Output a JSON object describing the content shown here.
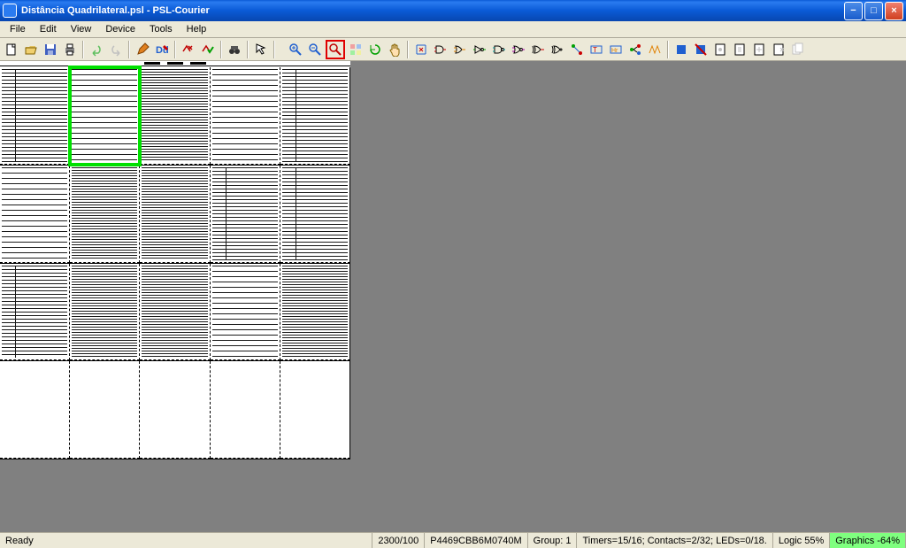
{
  "titlebar": {
    "title": "Distância Quadrilateral.psl - PSL-Courier"
  },
  "menu": {
    "file": "File",
    "edit": "Edit",
    "view": "View",
    "device": "Device",
    "tools": "Tools",
    "help": "Help"
  },
  "toolbar_icons": {
    "new": "new-file-icon",
    "open": "open-icon",
    "save": "save-icon",
    "print": "print-icon",
    "undo": "undo-icon",
    "redo": "redo-icon",
    "edit": "edit-pen-icon",
    "text": "text-tool-icon",
    "compile1": "compile-red-x-icon",
    "compile2": "compile-green-check-icon",
    "find": "binoculars-icon",
    "pointer": "pointer-icon",
    "zoom_in": "zoom-in-icon",
    "zoom_out": "zoom-out-icon",
    "zoom_fit": "zoom-fit-icon",
    "grid": "grid-icon",
    "refresh": "refresh-icon",
    "pan": "pan-hand-icon",
    "align": "align-icon",
    "gate_and": "gate-and-icon",
    "gate_or": "gate-or-icon",
    "gate_not": "gate-not-icon",
    "gate_nand": "gate-nand-icon",
    "gate_nor": "gate-nor-icon",
    "gate_xor": "gate-xor-icon",
    "gate_xnor": "gate-xnor-icon",
    "connect": "connect-icon",
    "timer": "timer-icon",
    "counter": "counter-icon",
    "node": "node-icon",
    "block": "block-icon",
    "delete": "delete-block-icon",
    "page1": "page-icon",
    "page2": "page-nav-icon",
    "page3": "page-add-icon",
    "page4": "page-del-icon",
    "page5": "page-dup-icon"
  },
  "status": {
    "ready": "Ready",
    "pos": "2300/100",
    "id": "P4469CBB6M0740M",
    "group": "Group: 1",
    "counts": "Timers=15/16; Contacts=2/32; LEDs=0/18.",
    "logic": "Logic 55%",
    "graphics": "Graphics -64%"
  }
}
